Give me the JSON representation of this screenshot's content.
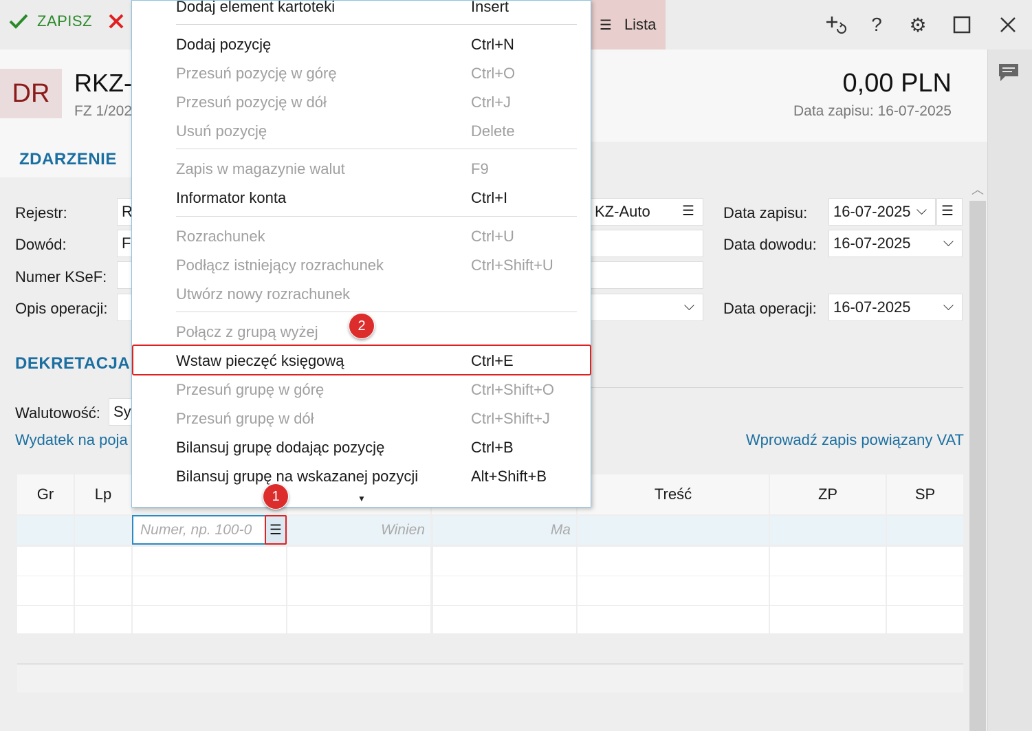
{
  "toolbar": {
    "save_label": "ZAPISZ",
    "cancel_icon": "close-red-icon",
    "lista_label": "Lista",
    "icons": [
      "add-related-icon",
      "help-icon",
      "settings-icon",
      "maximize-icon",
      "close-icon"
    ]
  },
  "header": {
    "badge": "DR",
    "title": "RKZ-",
    "subtitle": "FZ 1/202",
    "amount": "0,00 PLN",
    "date_label": "Data zapisu: 16-07-2025"
  },
  "tabs": {
    "zdarzenie": "ZDARZENIE"
  },
  "form": {
    "rejestr_label": "Rejestr:",
    "rejestr_value": "R",
    "dowod_label": "Dowód:",
    "dowod_value": "FZ",
    "ksef_label": "Numer KSeF:",
    "opis_label": "Opis operacji:",
    "right_value": "KZ-Auto",
    "data_zapisu_label": "Data zapisu:",
    "data_zapisu_value": "16-07-2025",
    "data_dowodu_label": "Data dowodu:",
    "data_dowodu_value": "16-07-2025",
    "data_operacji_label": "Data operacji:",
    "data_operacji_value": "16-07-2025"
  },
  "dekretacja": {
    "title": "DEKRETACJA",
    "walutowosc_label": "Walutowość:",
    "walutowosc_value": "Sys",
    "link_left": "Wydatek na poja",
    "link_right": "Wprowadź zapis powiązany VAT"
  },
  "grid": {
    "headers": {
      "gr": "Gr",
      "lp": "Lp",
      "tresc": "Treść",
      "zp": "ZP",
      "sp": "SP"
    },
    "konto_placeholder": "Numer, np. 100-0",
    "winien_placeholder": "Winien",
    "ma_placeholder": "Ma"
  },
  "menu": {
    "items": [
      {
        "label": "Dodaj element kartoteki",
        "shortcut": "Insert",
        "enabled": true
      },
      {
        "label": "Dodaj pozycję",
        "shortcut": "Ctrl+N",
        "enabled": true
      },
      {
        "label": "Przesuń pozycję w górę",
        "shortcut": "Ctrl+O",
        "enabled": false
      },
      {
        "label": "Przesuń pozycję w dół",
        "shortcut": "Ctrl+J",
        "enabled": false
      },
      {
        "label": "Usuń pozycję",
        "shortcut": "Delete",
        "enabled": false
      },
      {
        "label": "Zapis w magazynie walut",
        "shortcut": "F9",
        "enabled": false
      },
      {
        "label": "Informator konta",
        "shortcut": "Ctrl+I",
        "enabled": true
      },
      {
        "label": "Rozrachunek",
        "shortcut": "Ctrl+U",
        "enabled": false
      },
      {
        "label": "Podłącz istniejący rozrachunek",
        "shortcut": "Ctrl+Shift+U",
        "enabled": false
      },
      {
        "label": "Utwórz nowy rozrachunek",
        "shortcut": "",
        "enabled": false
      },
      {
        "label": "Połącz z grupą wyżej",
        "shortcut": "",
        "enabled": false
      },
      {
        "label": "Wstaw pieczęć księgową",
        "shortcut": "Ctrl+E",
        "enabled": true
      },
      {
        "label": "Przesuń grupę w górę",
        "shortcut": "Ctrl+Shift+O",
        "enabled": false
      },
      {
        "label": "Przesuń grupę w dół",
        "shortcut": "Ctrl+Shift+J",
        "enabled": false
      },
      {
        "label": "Bilansuj grupę dodając pozycję",
        "shortcut": "Ctrl+B",
        "enabled": true
      },
      {
        "label": "Bilansuj grupę na wskazanej pozycji",
        "shortcut": "Alt+Shift+B",
        "enabled": true
      }
    ]
  },
  "markers": {
    "one": "1",
    "two": "2"
  },
  "colors": {
    "accent": "#1b6fa0",
    "highlight": "#dd2222",
    "lista_bg": "#e8cfcd"
  }
}
